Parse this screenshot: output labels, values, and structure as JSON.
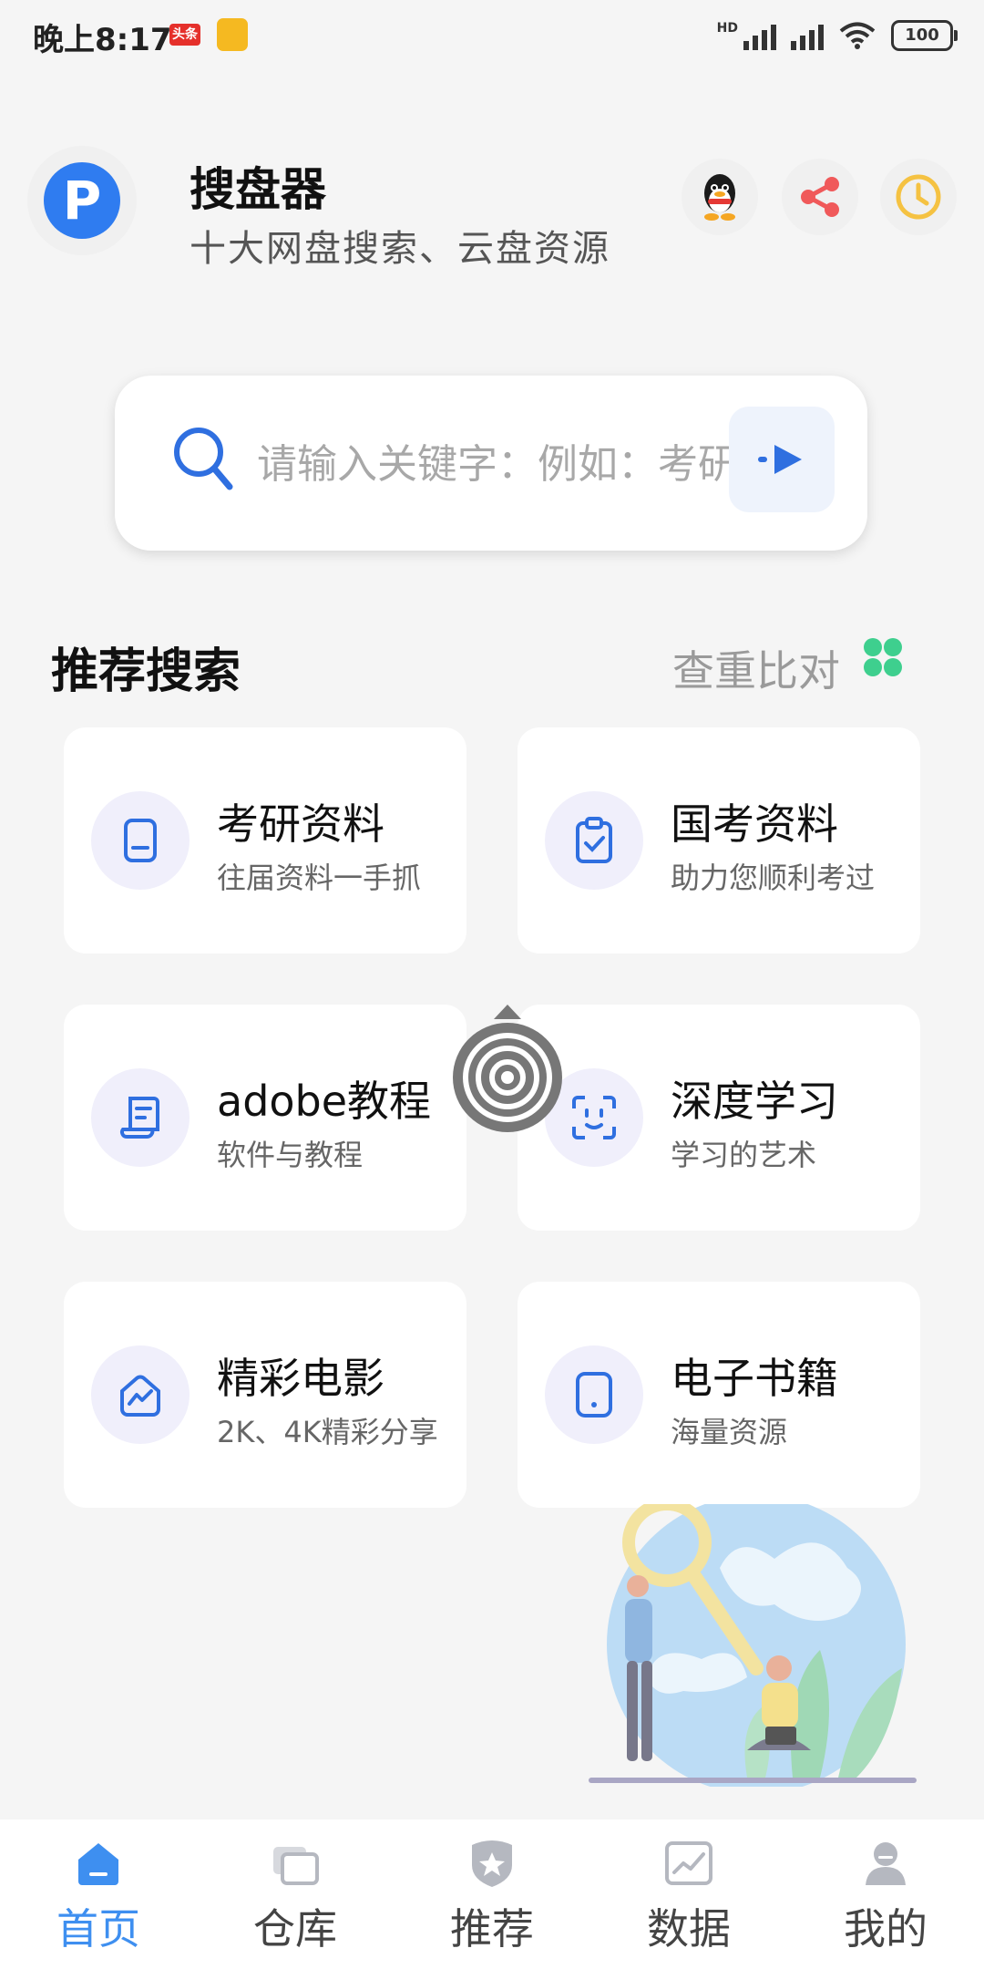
{
  "status_bar": {
    "time": "晚上8:17",
    "toutiao_badge": "头条",
    "network": "HD",
    "battery": "100"
  },
  "header": {
    "logo_letter": "P",
    "title": "搜盘器",
    "subtitle": "十大网盘搜索、云盘资源"
  },
  "search": {
    "placeholder": "请输入关键字：例如：考研"
  },
  "recommend": {
    "title": "推荐搜索",
    "compare_label": "查重比对",
    "cards": [
      {
        "title": "考研资料",
        "subtitle": "往届资料一手抓",
        "icon": "document-icon"
      },
      {
        "title": "国考资料",
        "subtitle": "助力您顺利考过",
        "icon": "clipboard-check-icon"
      },
      {
        "title": "adobe教程",
        "subtitle": "软件与教程",
        "icon": "scroll-icon"
      },
      {
        "title": "深度学习",
        "subtitle": "学习的艺术",
        "icon": "face-scan-icon"
      },
      {
        "title": "精彩电影",
        "subtitle": "2K、4K精彩分享",
        "icon": "chart-area-icon"
      },
      {
        "title": "电子书籍",
        "subtitle": "海量资源",
        "icon": "tablet-icon"
      }
    ]
  },
  "bottom_nav": [
    {
      "label": "首页",
      "icon": "home-icon",
      "active": true
    },
    {
      "label": "仓库",
      "icon": "cards-icon",
      "active": false
    },
    {
      "label": "推荐",
      "icon": "star-badge-icon",
      "active": false
    },
    {
      "label": "数据",
      "icon": "trend-chart-icon",
      "active": false
    },
    {
      "label": "我的",
      "icon": "user-icon",
      "active": false
    }
  ],
  "colors": {
    "accent": "#3e8ff0",
    "icon_blue": "#2f6fe0",
    "compare_green": "#3ecf8e",
    "share_red": "#f0595a",
    "history_yellow": "#f5c242"
  }
}
